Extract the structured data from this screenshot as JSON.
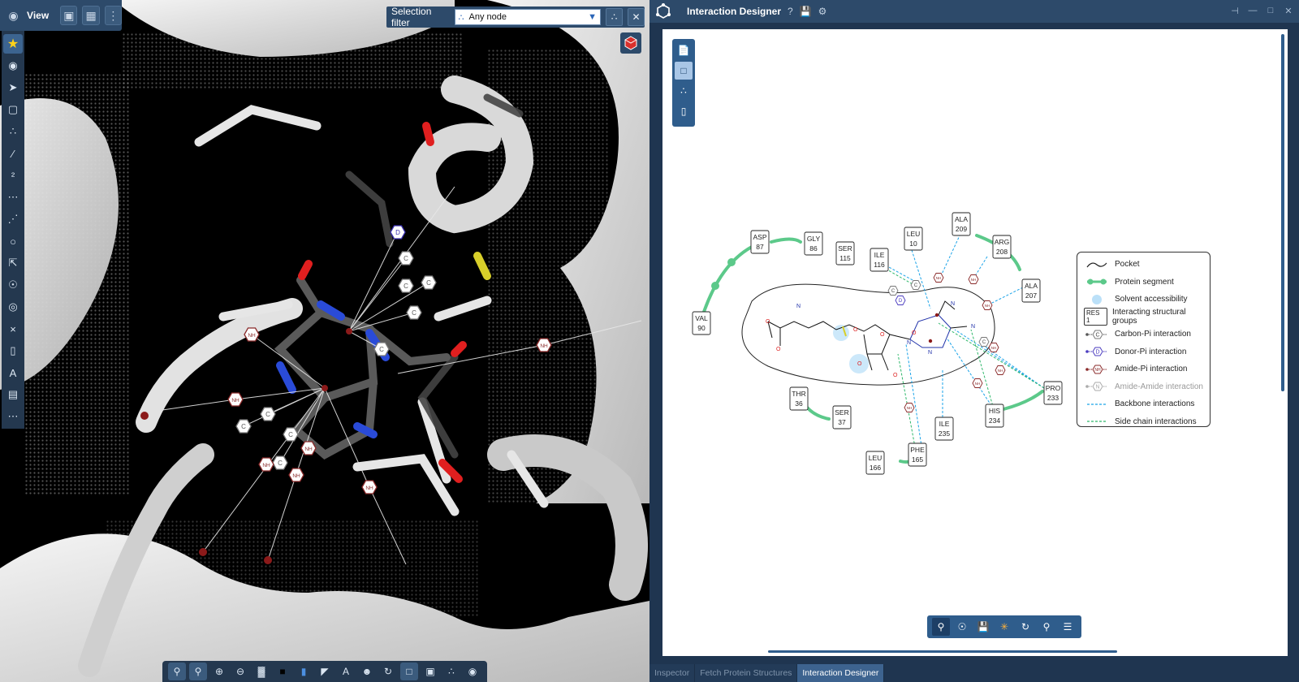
{
  "viewer": {
    "title": "View",
    "selection_filter_label": "Selection filter",
    "selection_filter_value": "Any node",
    "left_tool_icons": [
      "star-icon",
      "eye-icon",
      "pointer-icon",
      "rect-select-icon",
      "nodes-icon",
      "pipette-icon",
      "charge-icon",
      "add-path-icon",
      "add-dots-icon",
      "lasso-icon",
      "pointer-box-icon",
      "bond-icon",
      "ring-icon",
      "xx-icon",
      "eraser-icon",
      "text-icon",
      "ruler-icon",
      "more-icon"
    ],
    "bottom_tool_icons": [
      "zoom-fit-icon",
      "zoom-selection-icon",
      "zoom-in-icon",
      "zoom-out-icon",
      "hatch-icon",
      "black-square-icon",
      "box-icon",
      "surface-icon",
      "label-icon",
      "head-icon",
      "rotate-icon",
      "select-icon",
      "panel-icon",
      "nodes-icon",
      "eye-icon"
    ],
    "scene_labels": {
      "donor": "D",
      "carbon": "C",
      "amide": "NH"
    }
  },
  "designer": {
    "title": "Interaction Designer",
    "help_icon": "?",
    "residues": [
      {
        "name": "ASP",
        "num": "87"
      },
      {
        "name": "GLY",
        "num": "86"
      },
      {
        "name": "SER",
        "num": "115"
      },
      {
        "name": "ILE",
        "num": "116"
      },
      {
        "name": "LEU",
        "num": "10"
      },
      {
        "name": "ALA",
        "num": "209"
      },
      {
        "name": "ARG",
        "num": "208"
      },
      {
        "name": "ALA",
        "num": "207"
      },
      {
        "name": "VAL",
        "num": "90"
      },
      {
        "name": "THR",
        "num": "36"
      },
      {
        "name": "SER",
        "num": "37"
      },
      {
        "name": "PRO",
        "num": "233"
      },
      {
        "name": "HIS",
        "num": "234"
      },
      {
        "name": "ILE",
        "num": "235"
      },
      {
        "name": "PHE",
        "num": "165"
      },
      {
        "name": "LEU",
        "num": "166"
      }
    ],
    "legend": [
      {
        "label": "Pocket",
        "symbol": "pocket-icon"
      },
      {
        "label": "Protein segment",
        "symbol": "segment-icon"
      },
      {
        "label": "Solvent accessibility",
        "symbol": "solvent-icon"
      },
      {
        "label": "Interacting structural groups",
        "symbol": "RES 1"
      },
      {
        "label": "Carbon-Pi interaction",
        "symbol": "C"
      },
      {
        "label": "Donor-Pi interaction",
        "symbol": "D"
      },
      {
        "label": "Amide-Pi interaction",
        "symbol": "NH"
      },
      {
        "label": "Amide-Amide interaction",
        "symbol": "N"
      },
      {
        "label": "Backbone interactions",
        "symbol": "dashed-blue"
      },
      {
        "label": "Side chain interactions",
        "symbol": "dashed-green"
      }
    ],
    "atom_labels": [
      "N",
      "N",
      "N",
      "N",
      "N",
      "O",
      "O",
      "O",
      "O",
      "O",
      "O",
      "O"
    ],
    "tabs": [
      "Inspector",
      "Fetch Protein Structures",
      "Interaction Designer"
    ],
    "active_tab": "Interaction Designer",
    "colors": {
      "segment": "#5cc98a",
      "backbone": "#1aa3e8",
      "sidechain": "#2fb86b",
      "donor": "#4a3bbf",
      "amide": "#8a2a2a"
    }
  }
}
